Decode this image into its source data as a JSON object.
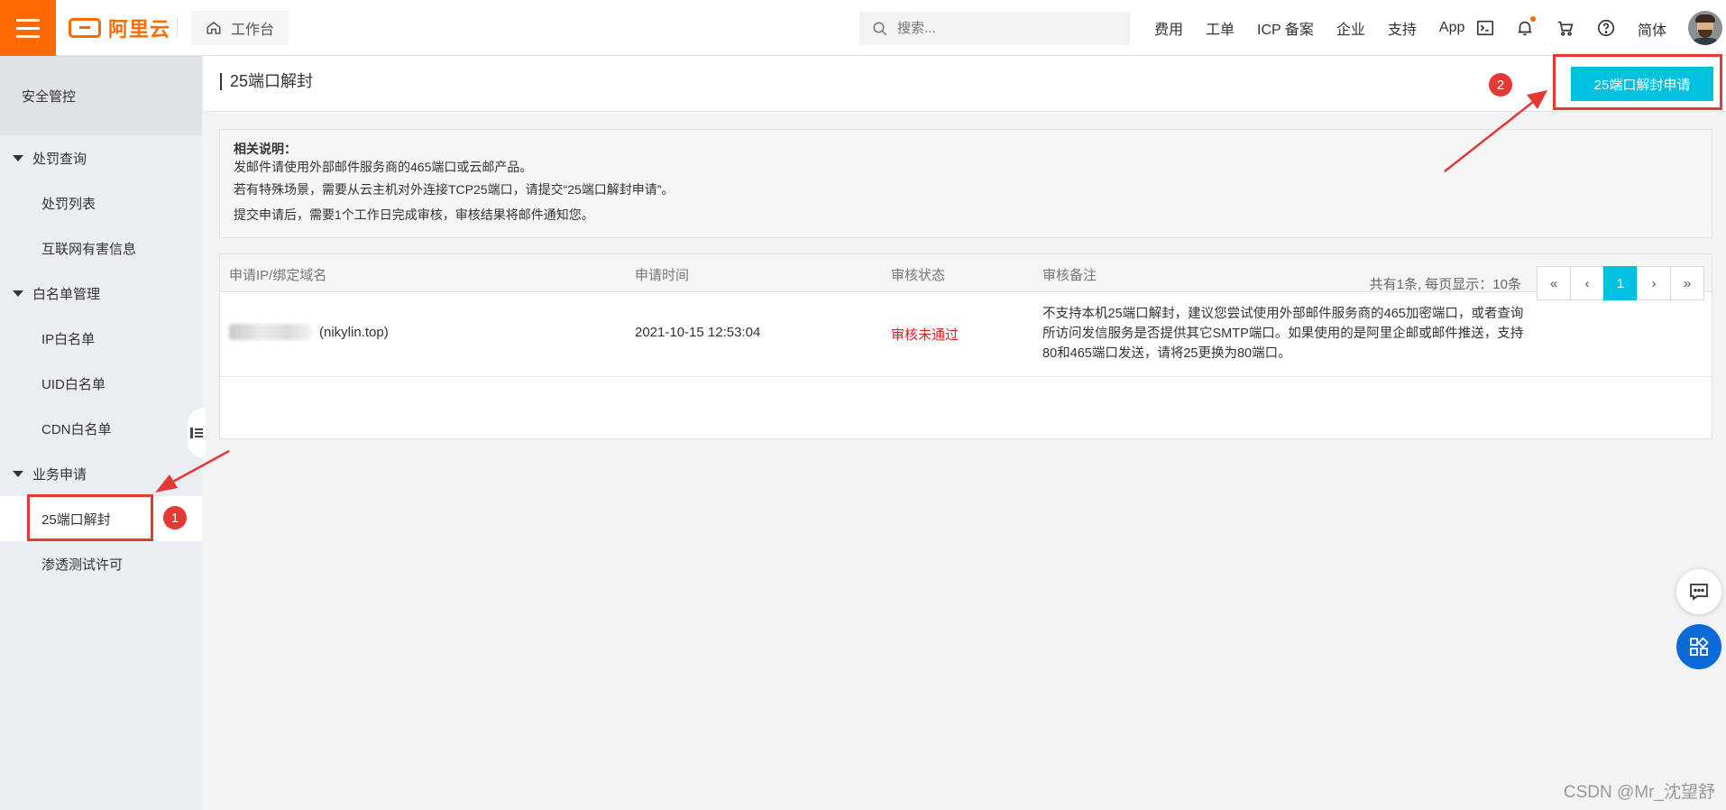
{
  "topbar": {
    "logo_text": "阿里云",
    "workbench_label": "工作台",
    "search_placeholder": "搜索...",
    "nav_links": [
      "费用",
      "工单",
      "ICP 备案",
      "企业",
      "支持",
      "App"
    ],
    "language": "简体",
    "brand_color": "#ff6a00"
  },
  "sidebar": {
    "title": "安全管控",
    "groups": [
      {
        "label": "处罚查询",
        "items": [
          "处罚列表",
          "互联网有害信息"
        ]
      },
      {
        "label": "白名单管理",
        "items": [
          "IP白名单",
          "UID白名单",
          "CDN白名单"
        ]
      },
      {
        "label": "业务申请",
        "items": [
          "25端口解封",
          "渗透测试许可"
        ]
      }
    ],
    "active_item": "25端口解封"
  },
  "page": {
    "title": "25端口解封",
    "apply_button": "25端口解封申请",
    "accent_color": "#00c1de"
  },
  "notes": {
    "title": "相关说明：",
    "lines": [
      "发邮件请使用外部邮件服务商的465端口或云邮产品。",
      "若有特殊场景，需要从云主机对外连接TCP25端口，请提交“25端口解封申请”。",
      "提交申请后，需要1个工作日完成审核，审核结果将邮件通知您。"
    ]
  },
  "table": {
    "columns": [
      "申请IP/绑定域名",
      "申请时间",
      "审核状态",
      "审核备注"
    ],
    "rows": [
      {
        "ip_domain": "(nikylin.top)",
        "time": "2021-10-15 12:53:04",
        "status": "审核未通过",
        "remark": "不支持本机25端口解封，建议您尝试使用外部邮件服务商的465加密端口，或者查询所访问发信服务是否提供其它SMTP端口。如果使用的是阿里企邮或邮件推送，支持80和465端口发送，请将25更换为80端口。"
      }
    ],
    "status_color": "#e02020"
  },
  "pagination": {
    "summary": "共有1条, 每页显示：10条",
    "first": "«",
    "prev": "‹",
    "current": "1",
    "next": "›",
    "last": "»"
  },
  "annotations": {
    "step1": "1",
    "step2": "2",
    "color": "#e53935"
  },
  "watermark": "CSDN @Mr_沈望舒",
  "icons": [
    "menu-icon",
    "home-icon",
    "search-icon",
    "terminal-icon",
    "bell-icon",
    "cart-icon",
    "help-icon",
    "collapse-icon",
    "chat-icon",
    "apps-icon"
  ]
}
